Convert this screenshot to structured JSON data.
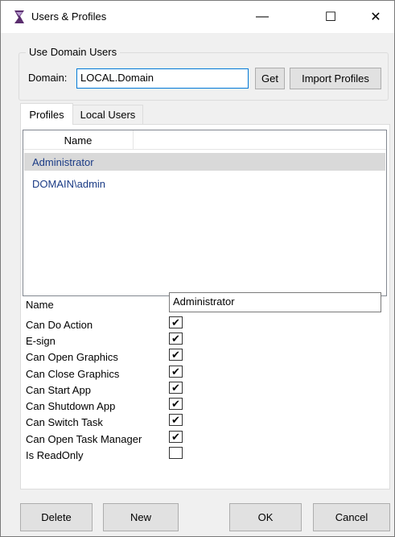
{
  "window": {
    "title": "Users & Profiles",
    "min_glyph": "—",
    "max_glyph": "☐",
    "close_glyph": "✕"
  },
  "domain_group": {
    "legend": "Use Domain Users",
    "domain_label": "Domain:",
    "domain_value": "LOCAL.Domain",
    "get_label": "Get",
    "import_label": "Import Profiles"
  },
  "tabs": [
    {
      "label": "Profiles",
      "active": true
    },
    {
      "label": "Local Users",
      "active": false
    }
  ],
  "list": {
    "column_header": "Name",
    "rows": [
      "Administrator",
      "DOMAIN\\admin"
    ],
    "selected_index": 0
  },
  "properties": {
    "name_label": "Name",
    "name_value": "Administrator",
    "permissions": [
      {
        "label": "Can Do Action",
        "checked": true
      },
      {
        "label": "E-sign",
        "checked": true
      },
      {
        "label": "Can Open Graphics",
        "checked": true
      },
      {
        "label": "Can Close Graphics",
        "checked": true
      },
      {
        "label": "Can Start App",
        "checked": true
      },
      {
        "label": "Can Shutdown App",
        "checked": true
      },
      {
        "label": "Can Switch Task",
        "checked": true
      },
      {
        "label": "Can Open Task Manager",
        "checked": true
      },
      {
        "label": "Is ReadOnly",
        "checked": false
      }
    ],
    "check_glyph": "✔"
  },
  "footer": {
    "delete_label": "Delete",
    "new_label": "New",
    "ok_label": "OK",
    "cancel_label": "Cancel"
  },
  "colors": {
    "accent": "#0078d7",
    "list_text": "#1a3b85",
    "selected_row": "#d9d9d9"
  }
}
